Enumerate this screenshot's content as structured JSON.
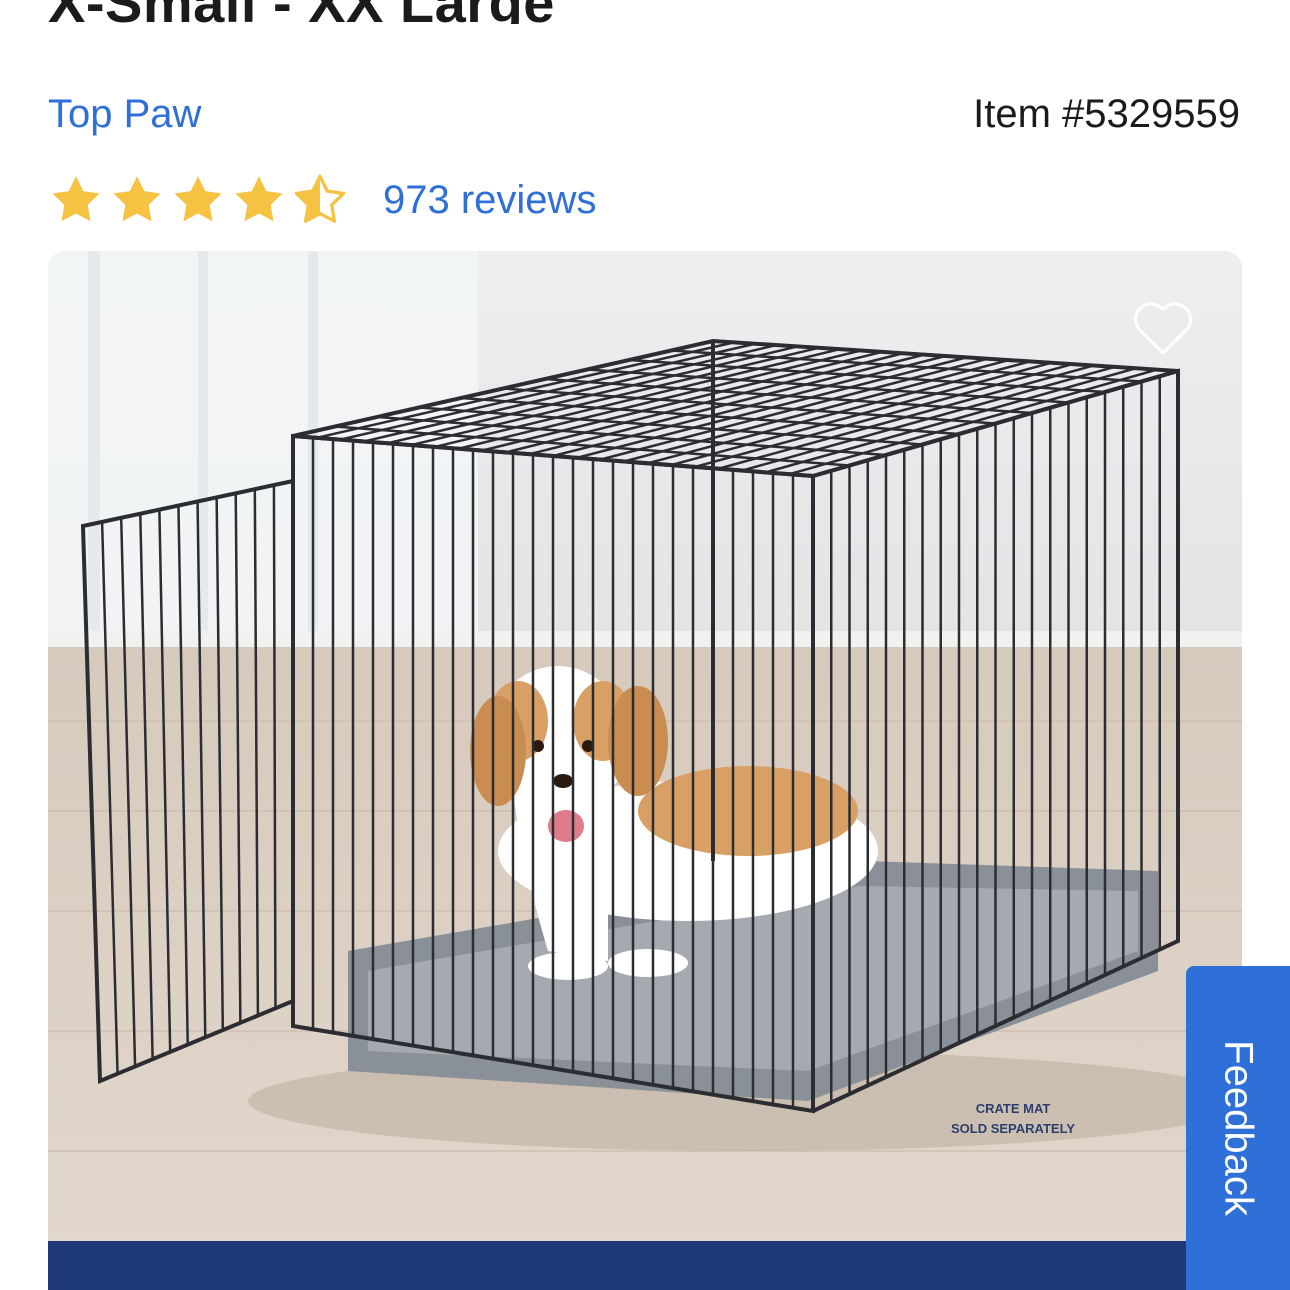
{
  "product": {
    "title": "X-Small - XX Large",
    "brand": "Top Paw",
    "item_number": "Item #5329559"
  },
  "rating": {
    "value": 4.5,
    "max": 5,
    "reviews_label": "973 reviews",
    "star_color": "#f5c242"
  },
  "image": {
    "caption_line1": "CRATE MAT",
    "caption_line2": "SOLD SEPARATELY",
    "favorite_icon": "heart-outline-icon"
  },
  "feedback": {
    "label": "Feedback"
  },
  "colors": {
    "link": "#2f6fd8",
    "banner": "#1f3878",
    "feedback_bg": "#2f6fd8"
  }
}
